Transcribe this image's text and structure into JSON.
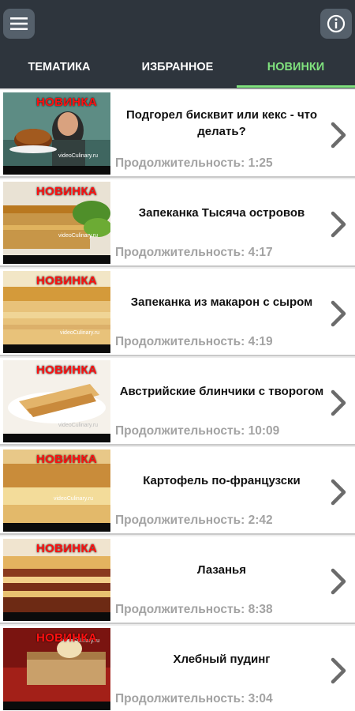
{
  "header": {
    "menu_icon": "hamburger-menu-icon",
    "info_icon": "info-icon"
  },
  "tabs": [
    {
      "label": "ТЕМАТИКА",
      "active": false
    },
    {
      "label": "ИЗБРАННОЕ",
      "active": false
    },
    {
      "label": "НОВИНКИ",
      "active": true
    }
  ],
  "colors": {
    "bar": "#2e353d",
    "active_tab": "#80e27e",
    "badge": "#ff1010"
  },
  "videos": [
    {
      "badge": "НОВИНКА",
      "title": "Подгорел бисквит или кекс - что делать?",
      "duration": "Продолжительность: 1:25"
    },
    {
      "badge": "НОВИНКА",
      "title": "Запеканка Тысяча островов",
      "duration": "Продолжительность: 4:17"
    },
    {
      "badge": "НОВИНКА",
      "title": "Запеканка из макарон с сыром",
      "duration": "Продолжительность: 4:19"
    },
    {
      "badge": "НОВИНКА",
      "title": "Австрийские блинчики с творогом",
      "duration": "Продолжительность: 10:09"
    },
    {
      "badge": "НОВИНКА",
      "title": "Картофель по-французски",
      "duration": "Продолжительность: 2:42"
    },
    {
      "badge": "НОВИНКА",
      "title": "Лазанья",
      "duration": "Продолжительность: 8:38"
    },
    {
      "badge": "НОВИНКА",
      "title": "Хлебный пудинг",
      "duration": "Продолжительность: 3:04"
    }
  ]
}
